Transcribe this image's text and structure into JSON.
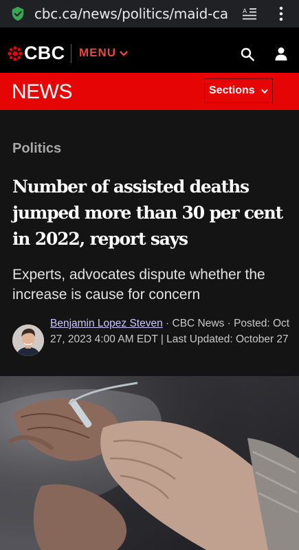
{
  "browser": {
    "url": "cbc.ca/news/politics/maid-ca"
  },
  "header": {
    "logo_text": "CBC",
    "menu_label": "MENU"
  },
  "newsbar": {
    "title": "NEWS",
    "sections_label": "Sections"
  },
  "article": {
    "kicker": "Politics",
    "headline": "Number of assisted deaths jumped more than 30 per cent in 2022, report says",
    "deck": "Experts, advocates dispute whether the increase is cause for concern",
    "byline": {
      "author": "Benjamin Lopez Steven",
      "outlet": "· CBC News ·",
      "posted": "Posted: Oct 27, 2023 4:00 AM EDT | Last Updated: October 27"
    }
  },
  "colors": {
    "cbc_red": "#e60505",
    "menu_red": "#e8473e",
    "shield_green": "#34a853",
    "background": "#141414"
  },
  "icons": [
    "shield-check-icon",
    "reader-mode-icon",
    "kebab-menu-icon",
    "cbc-gem-icon",
    "chevron-down-icon",
    "search-icon",
    "user-icon"
  ]
}
